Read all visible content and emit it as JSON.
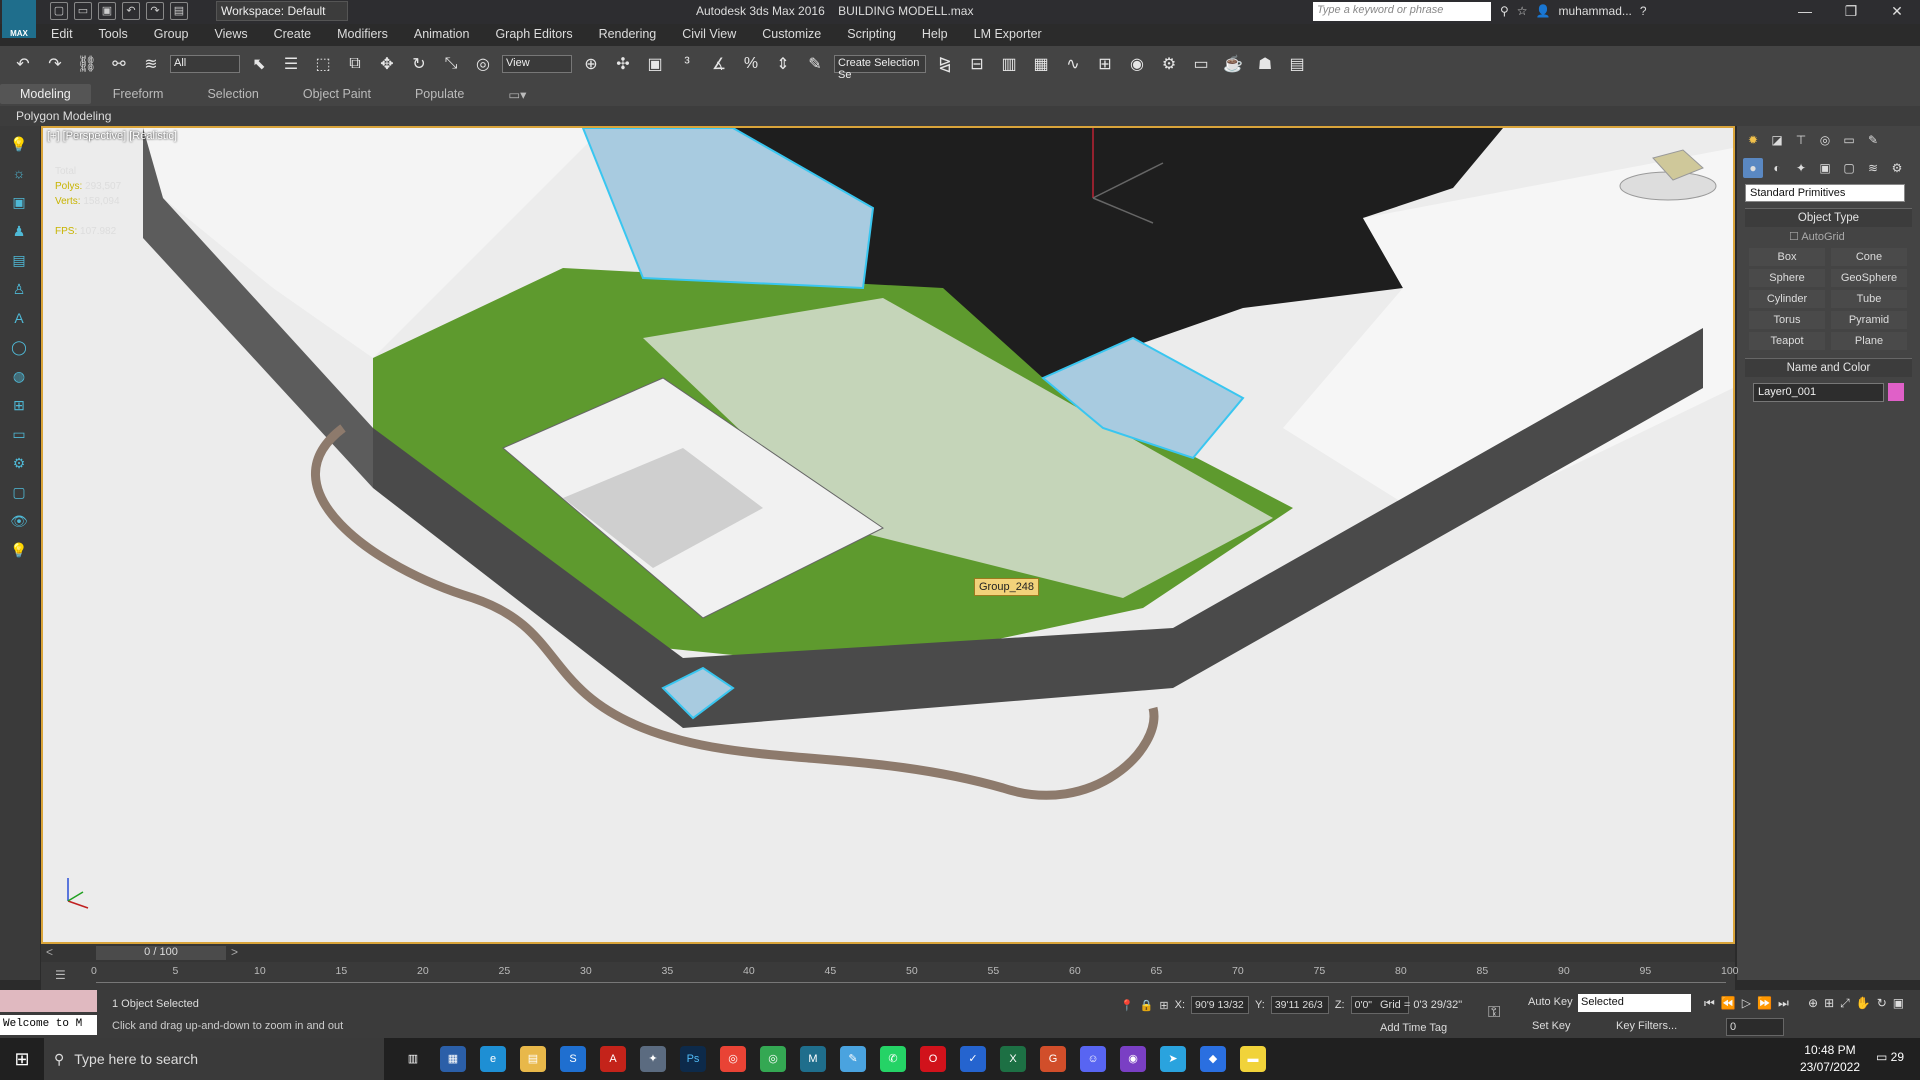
{
  "app": {
    "logo": "MAX",
    "title": "Autodesk 3ds Max 2016",
    "filename": "BUILDING MODELL.max"
  },
  "workspace": {
    "label": "Workspace: Default"
  },
  "search": {
    "placeholder": "Type a keyword or phrase"
  },
  "user": {
    "name": "muhammad..."
  },
  "window_controls": {
    "minimize": "—",
    "maximize": "❐",
    "close": "✕"
  },
  "menu": [
    "Edit",
    "Tools",
    "Group",
    "Views",
    "Create",
    "Modifiers",
    "Animation",
    "Graph Editors",
    "Rendering",
    "Civil View",
    "Customize",
    "Scripting",
    "Help",
    "LM Exporter"
  ],
  "toolbar": {
    "selection_filter": "All",
    "ref_coord": "View",
    "selection_set": "Create Selection Se"
  },
  "ribbon": {
    "tabs": [
      "Modeling",
      "Freeform",
      "Selection",
      "Object Paint",
      "Populate"
    ],
    "active": "Modeling",
    "subtitle": "Polygon Modeling"
  },
  "viewport": {
    "label": "[+] [Perspective] [Realistic]",
    "stats": {
      "total": "Total",
      "polys_label": "Polys:",
      "polys": "293,507",
      "verts_label": "Verts:",
      "verts": "158,094",
      "fps_label": "FPS:",
      "fps": "107.982"
    },
    "tooltip": "Group_248"
  },
  "command_panel": {
    "category": "Standard Primitives",
    "object_type_title": "Object Type",
    "autogrid": "AutoGrid",
    "buttons": [
      "Box",
      "Cone",
      "Sphere",
      "GeoSphere",
      "Cylinder",
      "Tube",
      "Torus",
      "Pyramid",
      "Teapot",
      "Plane"
    ],
    "name_color_title": "Name and Color",
    "object_name": "Layer0_001",
    "object_color": "#e060c8"
  },
  "timeline": {
    "slider": "0 / 100",
    "ticks": [
      "0",
      "5",
      "10",
      "15",
      "20",
      "25",
      "30",
      "35",
      "40",
      "45",
      "50",
      "55",
      "60",
      "65",
      "70",
      "75",
      "80",
      "85",
      "90",
      "95",
      "100"
    ]
  },
  "status": {
    "welcome": "Welcome to M",
    "selected": "1 Object Selected",
    "prompt": "Click and drag up-and-down to zoom in and out",
    "x": "90'9 13/32",
    "y": "39'11 26/3",
    "z": "0'0\"",
    "grid": "Grid = 0'3 29/32\"",
    "add_time_tag": "Add Time Tag",
    "auto_key": "Auto Key",
    "set_key": "Set Key",
    "key_mode": "Selected",
    "key_filters": "Key Filters...",
    "frame": "0"
  },
  "taskbar": {
    "search": "Type here to search",
    "time": "10:48 PM",
    "date": "23/07/2022",
    "notifications": "29"
  }
}
